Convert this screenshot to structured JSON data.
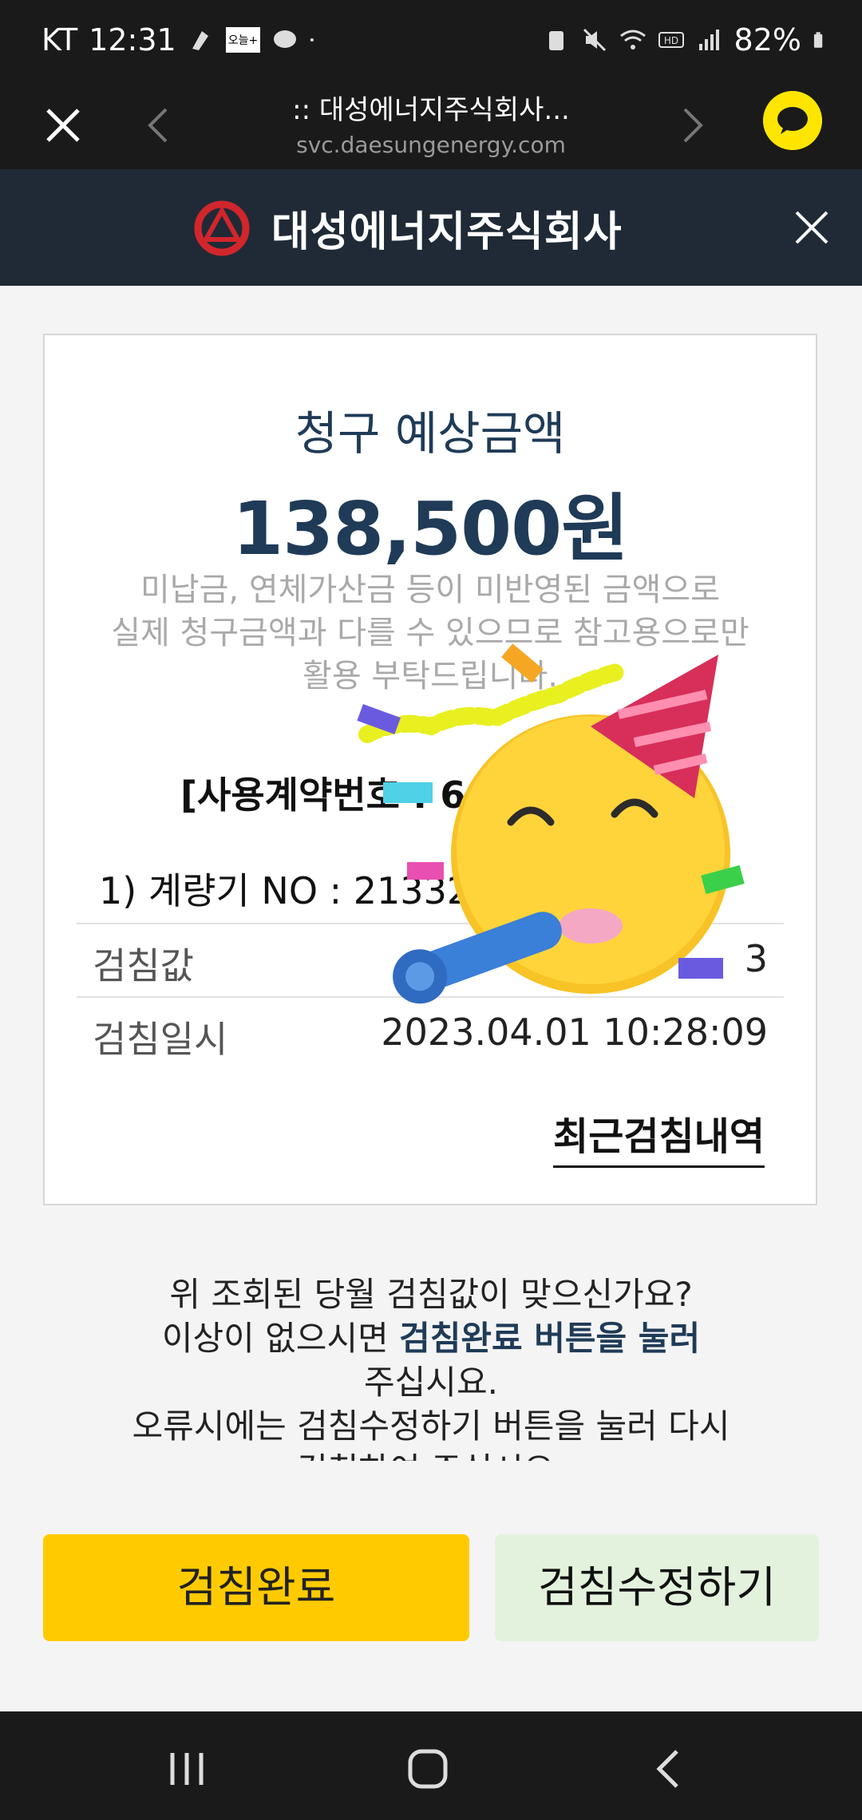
{
  "status_bar": {
    "carrier": "KT",
    "time": "12:31",
    "app_badge": "오늘+",
    "battery": "82%"
  },
  "browser": {
    "title": ":: 대성에너지주식회사...",
    "url": "svc.daesungenergy.com"
  },
  "site": {
    "brand": "대성에너지주식회사"
  },
  "card": {
    "title": "청구 예상금액",
    "amount": "138,500원",
    "notice_line1": "미납금, 연체가산금 등이 미반영된 금액으로",
    "notice_line2": "실제 청구금액과 다를 수 있으므로 참고용으로만",
    "notice_line3": "활용 부탁드립니다.",
    "contract_label": "[사용계약번호 : 60",
    "meter_label": "1) 계량기 NO : 21332",
    "rows": [
      {
        "key": "검침값",
        "value": "3"
      },
      {
        "key": "검침일시",
        "value": "2023.04.01 10:28:09"
      }
    ],
    "recent_link": "최근검침내역"
  },
  "info": {
    "line1": "위 조회된 당월 검침값이 맞으신가요?",
    "line2_prefix": "이상이 없으시면 ",
    "line2_highlight": "검침완료 버튼을 눌러",
    "line3": "주십시요.",
    "line4": "오류시에는 검침수정하기 버튼을 눌러 다시",
    "line5": "검침하여 주십시요."
  },
  "buttons": {
    "complete": "검침완료",
    "edit": "검침수정하기"
  },
  "colors": {
    "accent_navy": "#1f3b57",
    "complete_yellow": "#ffcb00",
    "edit_green": "#e3f2dd",
    "header_dark": "#1f2a36"
  },
  "icons": [
    "close-icon",
    "back-arrow-icon",
    "forward-arrow-icon",
    "kakao-chat-icon",
    "company-logo-icon",
    "party-face-sticker",
    "recent-apps-icon",
    "home-icon",
    "nav-back-icon"
  ]
}
